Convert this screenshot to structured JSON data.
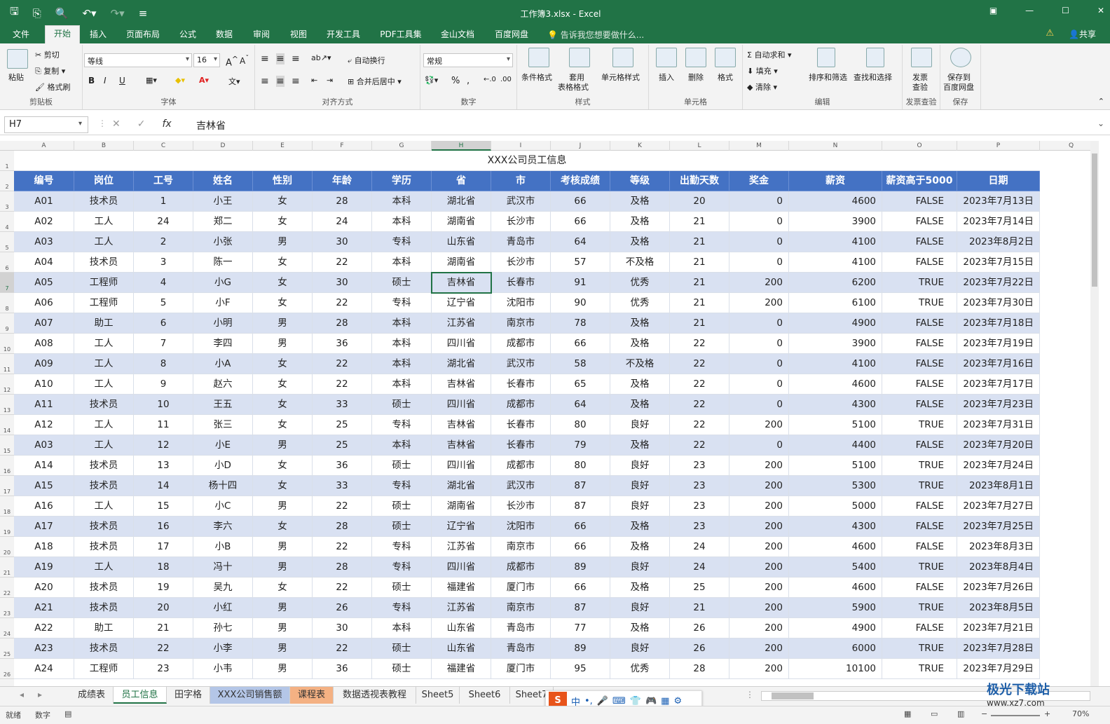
{
  "app": {
    "title": "工作簿3.xlsx - Excel"
  },
  "menu": {
    "tabs": [
      "文件",
      "开始",
      "插入",
      "页面布局",
      "公式",
      "数据",
      "审阅",
      "视图",
      "开发工具",
      "PDF工具集",
      "金山文档",
      "百度网盘"
    ],
    "active": "开始",
    "tell_me": "告诉我您想要做什么...",
    "share": "共享"
  },
  "ribbon": {
    "clipboard": {
      "label": "剪贴板",
      "paste": "粘贴",
      "cut": "剪切",
      "copy": "复制",
      "format_painter": "格式刷"
    },
    "font": {
      "label": "字体",
      "name": "等线",
      "size": "16",
      "bold": "B",
      "italic": "I",
      "underline": "U"
    },
    "alignment": {
      "label": "对齐方式",
      "wrap": "自动换行",
      "merge": "合并后居中"
    },
    "number": {
      "label": "数字",
      "format": "常规"
    },
    "styles": {
      "label": "样式",
      "conditional": "条件格式",
      "table_line1": "套用",
      "table_line2": "表格格式",
      "cell_styles": "单元格样式"
    },
    "cells": {
      "label": "单元格",
      "insert": "插入",
      "delete": "删除",
      "format": "格式"
    },
    "editing": {
      "label": "编辑",
      "autosum": "自动求和",
      "fill": "填充",
      "clear": "清除",
      "sort": "排序和筛选",
      "find": "查找和选择"
    },
    "invoice": {
      "label": "发票查验",
      "btn_line1": "发票",
      "btn_line2": "查验"
    },
    "save": {
      "label": "保存",
      "btn_line1": "保存到",
      "btn_line2": "百度网盘"
    }
  },
  "formula": {
    "name_box": "H7",
    "value": "吉林省"
  },
  "columns": [
    "A",
    "B",
    "C",
    "D",
    "E",
    "F",
    "G",
    "H",
    "I",
    "J",
    "K",
    "L",
    "M",
    "N",
    "O",
    "P",
    "Q"
  ],
  "selected_column": "H",
  "selected_row": 7,
  "sheet": {
    "title": "XXX公司员工信息",
    "headers": [
      "编号",
      "岗位",
      "工号",
      "姓名",
      "性别",
      "年龄",
      "学历",
      "省",
      "市",
      "考核成绩",
      "等级",
      "出勤天数",
      "奖金",
      "薪资",
      "薪资高于5000",
      "日期"
    ],
    "rows": [
      [
        "A01",
        "技术员",
        "1",
        "小王",
        "女",
        "28",
        "本科",
        "湖北省",
        "武汉市",
        "66",
        "及格",
        "20",
        "0",
        "4600",
        "FALSE",
        "2023年7月13日"
      ],
      [
        "A02",
        "工人",
        "24",
        "郑二",
        "女",
        "24",
        "本科",
        "湖南省",
        "长沙市",
        "66",
        "及格",
        "21",
        "0",
        "3900",
        "FALSE",
        "2023年7月14日"
      ],
      [
        "A03",
        "工人",
        "2",
        "小张",
        "男",
        "30",
        "专科",
        "山东省",
        "青岛市",
        "64",
        "及格",
        "21",
        "0",
        "4100",
        "FALSE",
        "2023年8月2日"
      ],
      [
        "A04",
        "技术员",
        "3",
        "陈一",
        "女",
        "22",
        "本科",
        "湖南省",
        "长沙市",
        "57",
        "不及格",
        "21",
        "0",
        "4100",
        "FALSE",
        "2023年7月15日"
      ],
      [
        "A05",
        "工程师",
        "4",
        "小G",
        "女",
        "30",
        "硕士",
        "吉林省",
        "长春市",
        "91",
        "优秀",
        "21",
        "200",
        "6200",
        "TRUE",
        "2023年7月22日"
      ],
      [
        "A06",
        "工程师",
        "5",
        "小F",
        "女",
        "22",
        "专科",
        "辽宁省",
        "沈阳市",
        "90",
        "优秀",
        "21",
        "200",
        "6100",
        "TRUE",
        "2023年7月30日"
      ],
      [
        "A07",
        "助工",
        "6",
        "小明",
        "男",
        "28",
        "本科",
        "江苏省",
        "南京市",
        "78",
        "及格",
        "21",
        "0",
        "4900",
        "FALSE",
        "2023年7月18日"
      ],
      [
        "A08",
        "工人",
        "7",
        "李四",
        "男",
        "36",
        "本科",
        "四川省",
        "成都市",
        "66",
        "及格",
        "22",
        "0",
        "3900",
        "FALSE",
        "2023年7月19日"
      ],
      [
        "A09",
        "工人",
        "8",
        "小A",
        "女",
        "22",
        "本科",
        "湖北省",
        "武汉市",
        "58",
        "不及格",
        "22",
        "0",
        "4100",
        "FALSE",
        "2023年7月16日"
      ],
      [
        "A10",
        "工人",
        "9",
        "赵六",
        "女",
        "22",
        "本科",
        "吉林省",
        "长春市",
        "65",
        "及格",
        "22",
        "0",
        "4600",
        "FALSE",
        "2023年7月17日"
      ],
      [
        "A11",
        "技术员",
        "10",
        "王五",
        "女",
        "33",
        "硕士",
        "四川省",
        "成都市",
        "64",
        "及格",
        "22",
        "0",
        "4300",
        "FALSE",
        "2023年7月23日"
      ],
      [
        "A12",
        "工人",
        "11",
        "张三",
        "女",
        "25",
        "专科",
        "吉林省",
        "长春市",
        "80",
        "良好",
        "22",
        "200",
        "5100",
        "TRUE",
        "2023年7月31日"
      ],
      [
        "A03",
        "工人",
        "12",
        "小E",
        "男",
        "25",
        "本科",
        "吉林省",
        "长春市",
        "79",
        "及格",
        "22",
        "0",
        "4400",
        "FALSE",
        "2023年7月20日"
      ],
      [
        "A14",
        "技术员",
        "13",
        "小D",
        "女",
        "36",
        "硕士",
        "四川省",
        "成都市",
        "80",
        "良好",
        "23",
        "200",
        "5100",
        "TRUE",
        "2023年7月24日"
      ],
      [
        "A15",
        "技术员",
        "14",
        "杨十四",
        "女",
        "33",
        "专科",
        "湖北省",
        "武汉市",
        "87",
        "良好",
        "23",
        "200",
        "5300",
        "TRUE",
        "2023年8月1日"
      ],
      [
        "A16",
        "工人",
        "15",
        "小C",
        "男",
        "22",
        "硕士",
        "湖南省",
        "长沙市",
        "87",
        "良好",
        "23",
        "200",
        "5000",
        "FALSE",
        "2023年7月27日"
      ],
      [
        "A17",
        "技术员",
        "16",
        "李六",
        "女",
        "28",
        "硕士",
        "辽宁省",
        "沈阳市",
        "66",
        "及格",
        "23",
        "200",
        "4300",
        "FALSE",
        "2023年7月25日"
      ],
      [
        "A18",
        "技术员",
        "17",
        "小B",
        "男",
        "22",
        "专科",
        "江苏省",
        "南京市",
        "66",
        "及格",
        "24",
        "200",
        "4600",
        "FALSE",
        "2023年8月3日"
      ],
      [
        "A19",
        "工人",
        "18",
        "冯十",
        "男",
        "28",
        "专科",
        "四川省",
        "成都市",
        "89",
        "良好",
        "24",
        "200",
        "5400",
        "TRUE",
        "2023年8月4日"
      ],
      [
        "A20",
        "技术员",
        "19",
        "吴九",
        "女",
        "22",
        "硕士",
        "福建省",
        "厦门市",
        "66",
        "及格",
        "25",
        "200",
        "4600",
        "FALSE",
        "2023年7月26日"
      ],
      [
        "A21",
        "技术员",
        "20",
        "小红",
        "男",
        "26",
        "专科",
        "江苏省",
        "南京市",
        "87",
        "良好",
        "21",
        "200",
        "5900",
        "TRUE",
        "2023年8月5日"
      ],
      [
        "A22",
        "助工",
        "21",
        "孙七",
        "男",
        "30",
        "本科",
        "山东省",
        "青岛市",
        "77",
        "及格",
        "26",
        "200",
        "4900",
        "FALSE",
        "2023年7月21日"
      ],
      [
        "A23",
        "技术员",
        "22",
        "小李",
        "男",
        "22",
        "硕士",
        "山东省",
        "青岛市",
        "89",
        "良好",
        "26",
        "200",
        "6000",
        "TRUE",
        "2023年7月28日"
      ],
      [
        "A24",
        "工程师",
        "23",
        "小韦",
        "男",
        "36",
        "硕士",
        "福建省",
        "厦门市",
        "95",
        "优秀",
        "28",
        "200",
        "10100",
        "TRUE",
        "2023年7月29日"
      ]
    ]
  },
  "sheet_tabs": [
    "成绩表",
    "员工信息",
    "田字格",
    "XXX公司销售额",
    "课程表",
    "数据透视表教程",
    "Sheet5",
    "Sheet6",
    "Sheet7"
  ],
  "active_sheet": "员工信息",
  "status": {
    "ready": "就绪",
    "mode": "数字",
    "zoom": "70%"
  },
  "ime": {
    "label": "中"
  },
  "watermark": {
    "name": "极光下载站",
    "url": "www.xz7.com"
  },
  "colors": {
    "excel_green": "#217346",
    "header_blue": "#4472c4",
    "band_blue": "#d9e1f2"
  }
}
